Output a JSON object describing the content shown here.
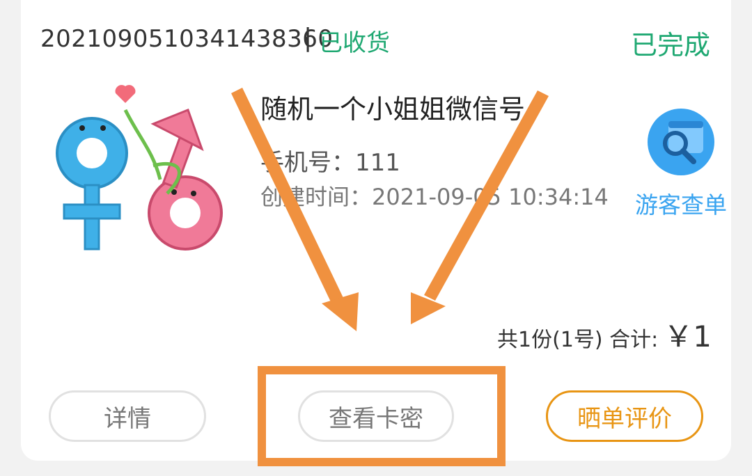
{
  "order": {
    "number": "20210905103414383​60",
    "separator": "|",
    "delivery_status": "已收货",
    "order_status": "已完成"
  },
  "product": {
    "title": "随机一个小姐姐微信号",
    "phone": "手机号：111",
    "created": "创建时间：2021-09-05 10:34:14",
    "thumbnail_icon": "gender-symbols-icon"
  },
  "guest_lookup": {
    "label": "游客查单",
    "icon": "search-icon"
  },
  "summary": {
    "count_text": "共1份(1号) 合计:",
    "price": "￥1"
  },
  "buttons": {
    "detail": "详情",
    "view_card": "查看卡密",
    "review": "晒单评价"
  },
  "colors": {
    "green": "#1fa872",
    "blue": "#3aa4f0",
    "orange_button": "#e89514",
    "annotation": "#f0913f"
  }
}
